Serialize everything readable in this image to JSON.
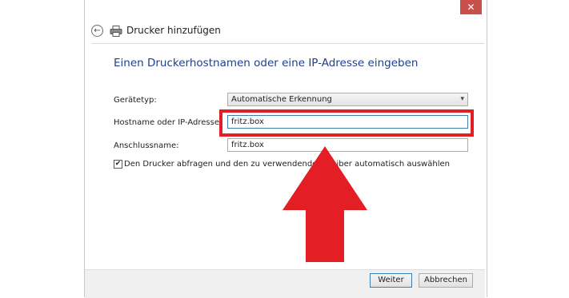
{
  "window": {
    "title": "Drucker hinzufügen",
    "close_glyph": "✕",
    "back_glyph": "←"
  },
  "heading": "Einen Druckerhostnamen oder eine IP-Adresse eingeben",
  "form": {
    "device_type_label": "Gerätetyp:",
    "device_type_value": "Automatische Erkennung",
    "hostname_label": "Hostname oder IP-Adresse:",
    "hostname_value": "fritz.box",
    "port_name_label": "Anschlussname:",
    "port_name_value": "fritz.box",
    "checkbox_label": "Den Drucker abfragen und den zu verwendenden Treiber automatisch auswählen",
    "checkbox_checked": true,
    "checkbox_glyph": "✔"
  },
  "buttons": {
    "next": "Weiter",
    "cancel": "Abbrechen"
  },
  "colors": {
    "heading": "#1e3f8a",
    "highlight": "#e41e25",
    "close": "#c7504b"
  },
  "icons": [
    "back-arrow-icon",
    "printer-icon",
    "close-icon",
    "chevron-down-icon",
    "red-arrow-annotation"
  ]
}
